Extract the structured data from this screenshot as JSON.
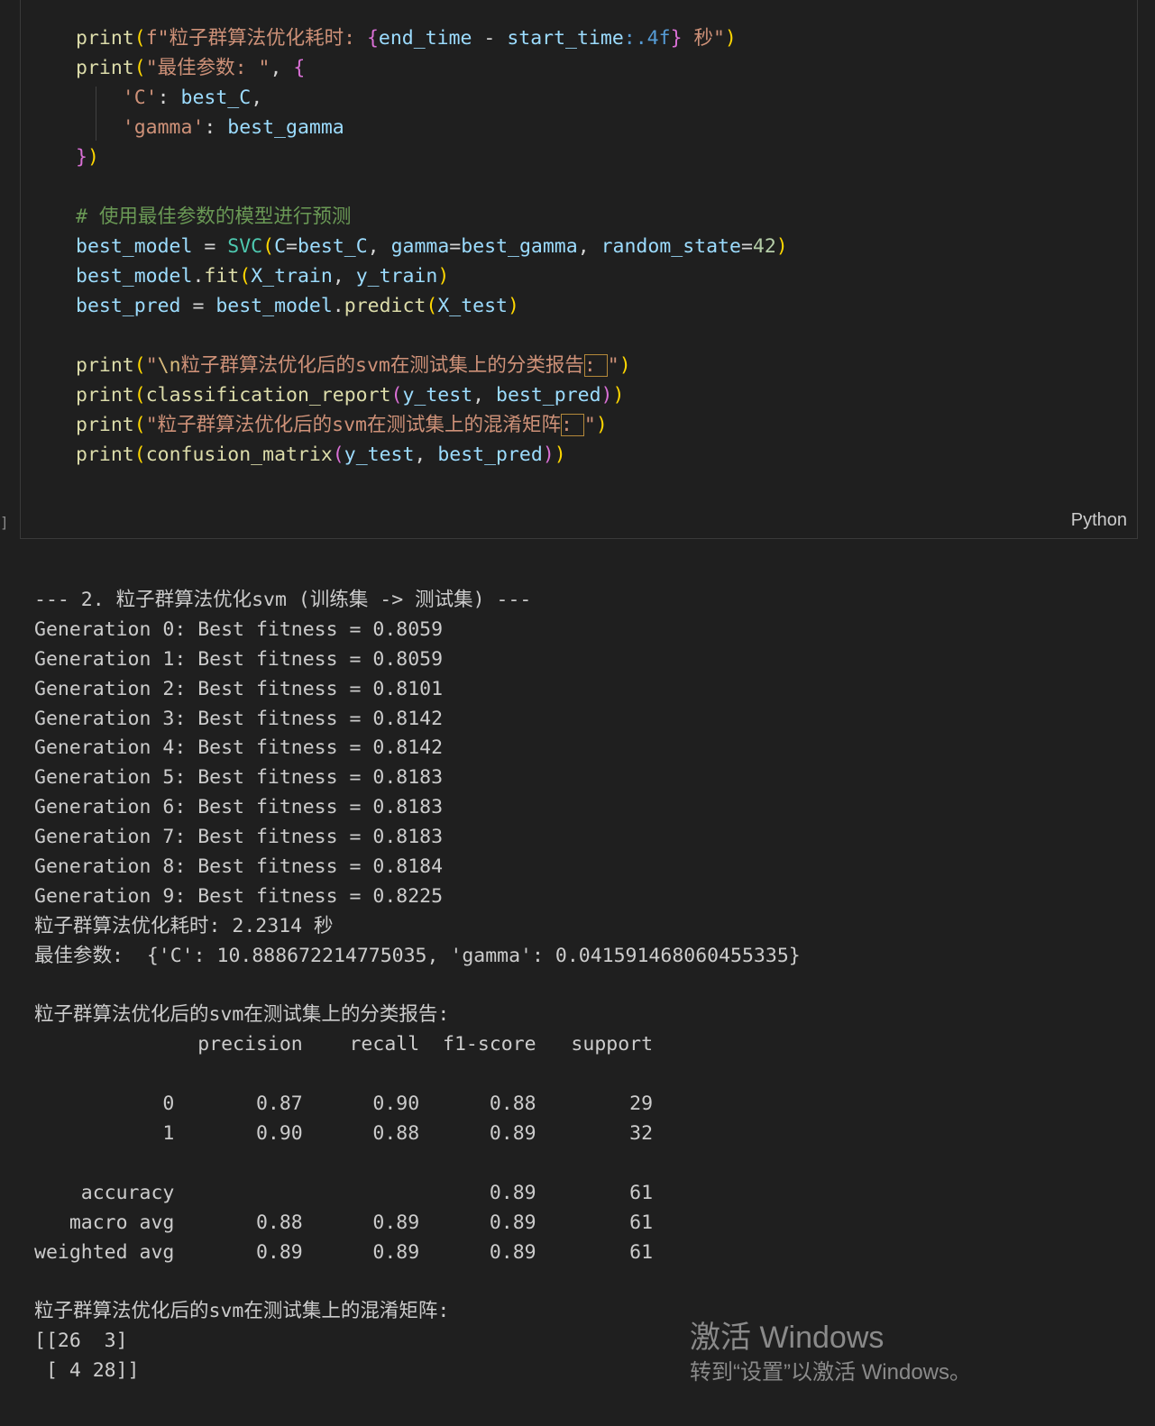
{
  "cell": {
    "language": "Python",
    "exec_marker": "]",
    "code_lines": [
      [
        {
          "t": "print",
          "c": "fn"
        },
        {
          "t": "(",
          "c": "b1"
        },
        {
          "t": "f\"粒子群算法优化耗时: ",
          "c": "str"
        },
        {
          "t": "{",
          "c": "b2"
        },
        {
          "t": "end_time",
          "c": "var"
        },
        {
          "t": " - ",
          "c": "op"
        },
        {
          "t": "start_time",
          "c": "var"
        },
        {
          "t": ":.4f",
          "c": "kw"
        },
        {
          "t": "}",
          "c": "b2"
        },
        {
          "t": " 秒\"",
          "c": "str"
        },
        {
          "t": ")",
          "c": "b1"
        }
      ],
      [
        {
          "t": "print",
          "c": "fn"
        },
        {
          "t": "(",
          "c": "b1"
        },
        {
          "t": "\"最佳参数: \"",
          "c": "str"
        },
        {
          "t": ", ",
          "c": "op"
        },
        {
          "t": "{",
          "c": "b2"
        }
      ],
      [
        {
          "t": "    ",
          "c": "op"
        },
        {
          "t": "'C'",
          "c": "str"
        },
        {
          "t": ": ",
          "c": "op"
        },
        {
          "t": "best_C",
          "c": "var"
        },
        {
          "t": ",",
          "c": "op"
        }
      ],
      [
        {
          "t": "    ",
          "c": "op"
        },
        {
          "t": "'gamma'",
          "c": "str"
        },
        {
          "t": ": ",
          "c": "op"
        },
        {
          "t": "best_gamma",
          "c": "var"
        }
      ],
      [
        {
          "t": "}",
          "c": "b2"
        },
        {
          "t": ")",
          "c": "b1"
        }
      ],
      [],
      [
        {
          "t": "# 使用最佳参数的模型进行预测",
          "c": "cmt"
        }
      ],
      [
        {
          "t": "best_model",
          "c": "var"
        },
        {
          "t": " = ",
          "c": "op"
        },
        {
          "t": "SVC",
          "c": "cls"
        },
        {
          "t": "(",
          "c": "b1"
        },
        {
          "t": "C",
          "c": "var"
        },
        {
          "t": "=",
          "c": "op"
        },
        {
          "t": "best_C",
          "c": "var"
        },
        {
          "t": ", ",
          "c": "op"
        },
        {
          "t": "gamma",
          "c": "var"
        },
        {
          "t": "=",
          "c": "op"
        },
        {
          "t": "best_gamma",
          "c": "var"
        },
        {
          "t": ", ",
          "c": "op"
        },
        {
          "t": "random_state",
          "c": "var"
        },
        {
          "t": "=",
          "c": "op"
        },
        {
          "t": "42",
          "c": "num"
        },
        {
          "t": ")",
          "c": "b1"
        }
      ],
      [
        {
          "t": "best_model",
          "c": "var"
        },
        {
          "t": ".",
          "c": "op"
        },
        {
          "t": "fit",
          "c": "fn"
        },
        {
          "t": "(",
          "c": "b1"
        },
        {
          "t": "X_train",
          "c": "var"
        },
        {
          "t": ", ",
          "c": "op"
        },
        {
          "t": "y_train",
          "c": "var"
        },
        {
          "t": ")",
          "c": "b1"
        }
      ],
      [
        {
          "t": "best_pred",
          "c": "var"
        },
        {
          "t": " = ",
          "c": "op"
        },
        {
          "t": "best_model",
          "c": "var"
        },
        {
          "t": ".",
          "c": "op"
        },
        {
          "t": "predict",
          "c": "fn"
        },
        {
          "t": "(",
          "c": "b1"
        },
        {
          "t": "X_test",
          "c": "var"
        },
        {
          "t": ")",
          "c": "b1"
        }
      ],
      [],
      [
        {
          "t": "print",
          "c": "fn"
        },
        {
          "t": "(",
          "c": "b1"
        },
        {
          "t": "\"",
          "c": "str"
        },
        {
          "t": "\\n",
          "c": "esc"
        },
        {
          "t": "粒子群算法优化后的svm在测试集上的分类报告",
          "c": "str"
        },
        {
          "t": ": ",
          "c": "str hl"
        },
        {
          "t": "\"",
          "c": "str"
        },
        {
          "t": ")",
          "c": "b1"
        }
      ],
      [
        {
          "t": "print",
          "c": "fn"
        },
        {
          "t": "(",
          "c": "b1"
        },
        {
          "t": "classification_report",
          "c": "fn"
        },
        {
          "t": "(",
          "c": "b2"
        },
        {
          "t": "y_test",
          "c": "var"
        },
        {
          "t": ", ",
          "c": "op"
        },
        {
          "t": "best_pred",
          "c": "var"
        },
        {
          "t": ")",
          "c": "b2"
        },
        {
          "t": ")",
          "c": "b1"
        }
      ],
      [
        {
          "t": "print",
          "c": "fn"
        },
        {
          "t": "(",
          "c": "b1"
        },
        {
          "t": "\"粒子群算法优化后的svm在测试集上的混淆矩阵",
          "c": "str"
        },
        {
          "t": ": ",
          "c": "str hl"
        },
        {
          "t": "\"",
          "c": "str"
        },
        {
          "t": ")",
          "c": "b1"
        }
      ],
      [
        {
          "t": "print",
          "c": "fn"
        },
        {
          "t": "(",
          "c": "b1"
        },
        {
          "t": "confusion_matrix",
          "c": "fn"
        },
        {
          "t": "(",
          "c": "b2"
        },
        {
          "t": "y_test",
          "c": "var"
        },
        {
          "t": ", ",
          "c": "op"
        },
        {
          "t": "best_pred",
          "c": "var"
        },
        {
          "t": ")",
          "c": "b2"
        },
        {
          "t": ")",
          "c": "b1"
        }
      ]
    ]
  },
  "output": {
    "lines": [
      "--- 2. 粒子群算法优化svm (训练集 -> 测试集) ---",
      "Generation 0: Best fitness = 0.8059",
      "Generation 1: Best fitness = 0.8059",
      "Generation 2: Best fitness = 0.8101",
      "Generation 3: Best fitness = 0.8142",
      "Generation 4: Best fitness = 0.8142",
      "Generation 5: Best fitness = 0.8183",
      "Generation 6: Best fitness = 0.8183",
      "Generation 7: Best fitness = 0.8183",
      "Generation 8: Best fitness = 0.8184",
      "Generation 9: Best fitness = 0.8225",
      "粒子群算法优化耗时: 2.2314 秒",
      "最佳参数:  {'C': 10.888672214775035, 'gamma': 0.041591468060455335}",
      "",
      "粒子群算法优化后的svm在测试集上的分类报告:",
      "              precision    recall  f1-score   support",
      "",
      "           0       0.87      0.90      0.88        29",
      "           1       0.90      0.88      0.89        32",
      "",
      "    accuracy                           0.89        61",
      "   macro avg       0.88      0.89      0.89        61",
      "weighted avg       0.89      0.89      0.89        61",
      "",
      "粒子群算法优化后的svm在测试集上的混淆矩阵:",
      "[[26  3]",
      " [ 4 28]]"
    ]
  },
  "watermark": {
    "title": "激活 Windows",
    "subtitle": "转到“设置”以激活 Windows。"
  }
}
